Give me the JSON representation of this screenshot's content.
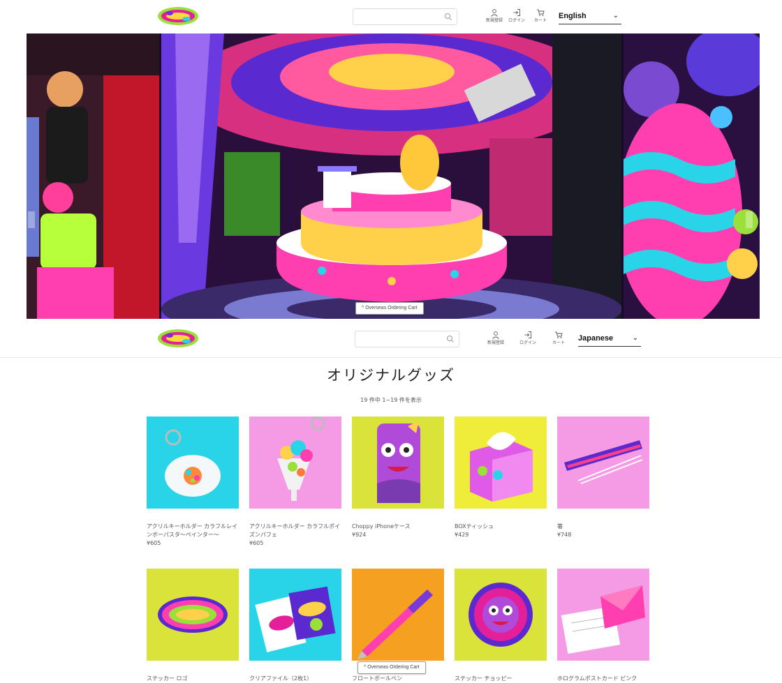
{
  "header_top": {
    "search_placeholder": "",
    "signup_label": "新規登録",
    "login_label": "ログイン",
    "cart_label": "カート",
    "language": "English"
  },
  "header_sticky": {
    "search_placeholder": "",
    "signup_label": "新規登録",
    "login_label": "ログイン",
    "cart_label": "カート",
    "language": "Japanese"
  },
  "overseas_cart_label": "Overseas Ordering Cart",
  "page": {
    "title": "オリジナルグッズ",
    "count_text": "19 件中 1~19 件を表示"
  },
  "products": [
    {
      "name": "アクリルキーホルダー カラフルレインボーパスタ〜ペインター〜",
      "price": "¥605",
      "bg": "#2ad4e8"
    },
    {
      "name": "アクリルキーホルダー カラフルポイズンパフェ",
      "price": "¥605",
      "bg": "#f59be6"
    },
    {
      "name": "Choppy iPhoneケース",
      "price": "¥924",
      "bg": "#d9e33a"
    },
    {
      "name": "BOXティッシュ",
      "price": "¥429",
      "bg": "#f0ec3a"
    },
    {
      "name": "箸",
      "price": "¥748",
      "bg": "#f59be6"
    },
    {
      "name": "ステッカー ロゴ",
      "price": "",
      "bg": "#d9e33a"
    },
    {
      "name": "クリアファイル（2枚1）",
      "price": "",
      "bg": "#2ad4e8"
    },
    {
      "name": "フロートボールペン",
      "price": "",
      "bg": "#f5a020"
    },
    {
      "name": "ステッカー チョッピー",
      "price": "",
      "bg": "#d9e33a"
    },
    {
      "name": "ホログラムポストカード ピンク",
      "price": "",
      "bg": "#f59be6"
    }
  ],
  "colors": {
    "accent_pink": "#e3209a",
    "accent_cyan": "#2ad4e8",
    "accent_yellow": "#d9e33a"
  }
}
